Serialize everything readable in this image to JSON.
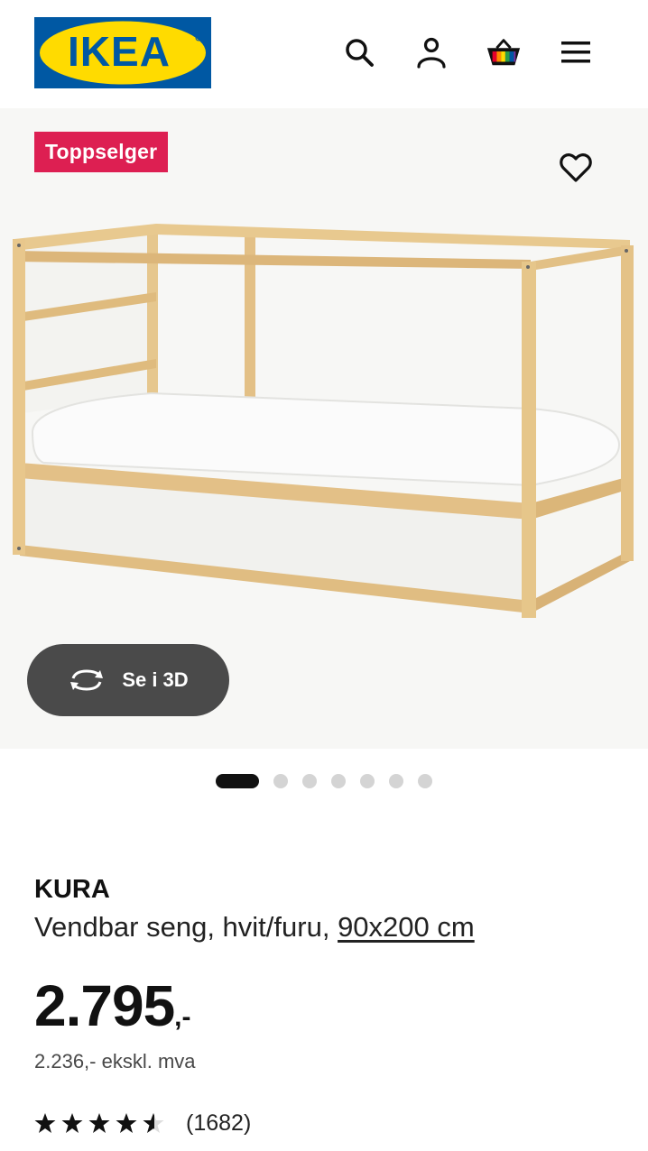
{
  "header": {
    "logo_text": "IKEA",
    "icons": [
      "search-icon",
      "user-icon",
      "basket-icon",
      "menu-icon"
    ],
    "logo_colors": {
      "blue": "#0058a3",
      "yellow": "#ffdb00"
    }
  },
  "gallery": {
    "badge": "Toppselger",
    "badge_color": "#dd1f52",
    "view_3d_label": "Se i 3D",
    "dots_total": 7,
    "dots_active_index": 0
  },
  "product": {
    "name": "KURA",
    "description": "Vendbar seng, hvit/furu,",
    "size": "90x200 cm",
    "price_main": "2.795",
    "price_suffix": ",-",
    "price_excl_vat": "2.236,- ekskl. mva",
    "rating_value": 4.5,
    "rating_max": 5,
    "review_count": "(1682)"
  }
}
